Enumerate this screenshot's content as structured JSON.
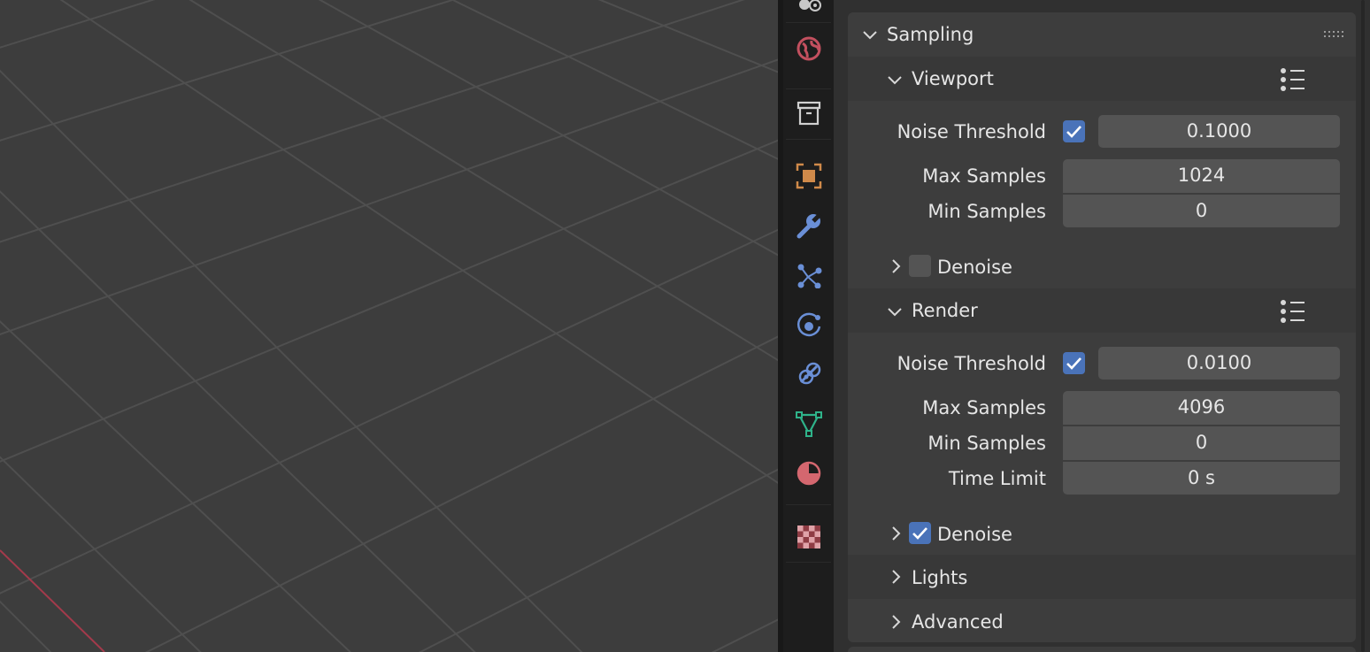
{
  "sampling": {
    "title": "Sampling",
    "viewport": {
      "title": "Viewport",
      "noise_threshold_label": "Noise Threshold",
      "noise_threshold_enabled": true,
      "noise_threshold_value": "0.1000",
      "max_samples_label": "Max Samples",
      "max_samples_value": "1024",
      "min_samples_label": "Min Samples",
      "min_samples_value": "0",
      "denoise_label": "Denoise",
      "denoise_enabled": false
    },
    "render": {
      "title": "Render",
      "noise_threshold_label": "Noise Threshold",
      "noise_threshold_enabled": true,
      "noise_threshold_value": "0.0100",
      "max_samples_label": "Max Samples",
      "max_samples_value": "4096",
      "min_samples_label": "Min Samples",
      "min_samples_value": "0",
      "time_limit_label": "Time Limit",
      "time_limit_value": "0 s",
      "denoise_label": "Denoise",
      "denoise_enabled": true
    },
    "lights_label": "Lights",
    "advanced_label": "Advanced"
  },
  "tabs": [
    {
      "icon": "scene-icon"
    },
    {
      "icon": "world-icon"
    },
    {
      "icon": "collection-icon"
    },
    {
      "icon": "object-icon"
    },
    {
      "icon": "modifier-icon"
    },
    {
      "icon": "particles-icon"
    },
    {
      "icon": "physics-icon"
    },
    {
      "icon": "constraints-icon"
    },
    {
      "icon": "object-data-icon"
    },
    {
      "icon": "material-icon"
    },
    {
      "icon": "texture-icon"
    }
  ],
  "colors": {
    "accent": "#4a73b9",
    "viewport_bg": "#3d3d3d",
    "grid": "#4d4d4d",
    "x_axis": "#a33a4b"
  }
}
